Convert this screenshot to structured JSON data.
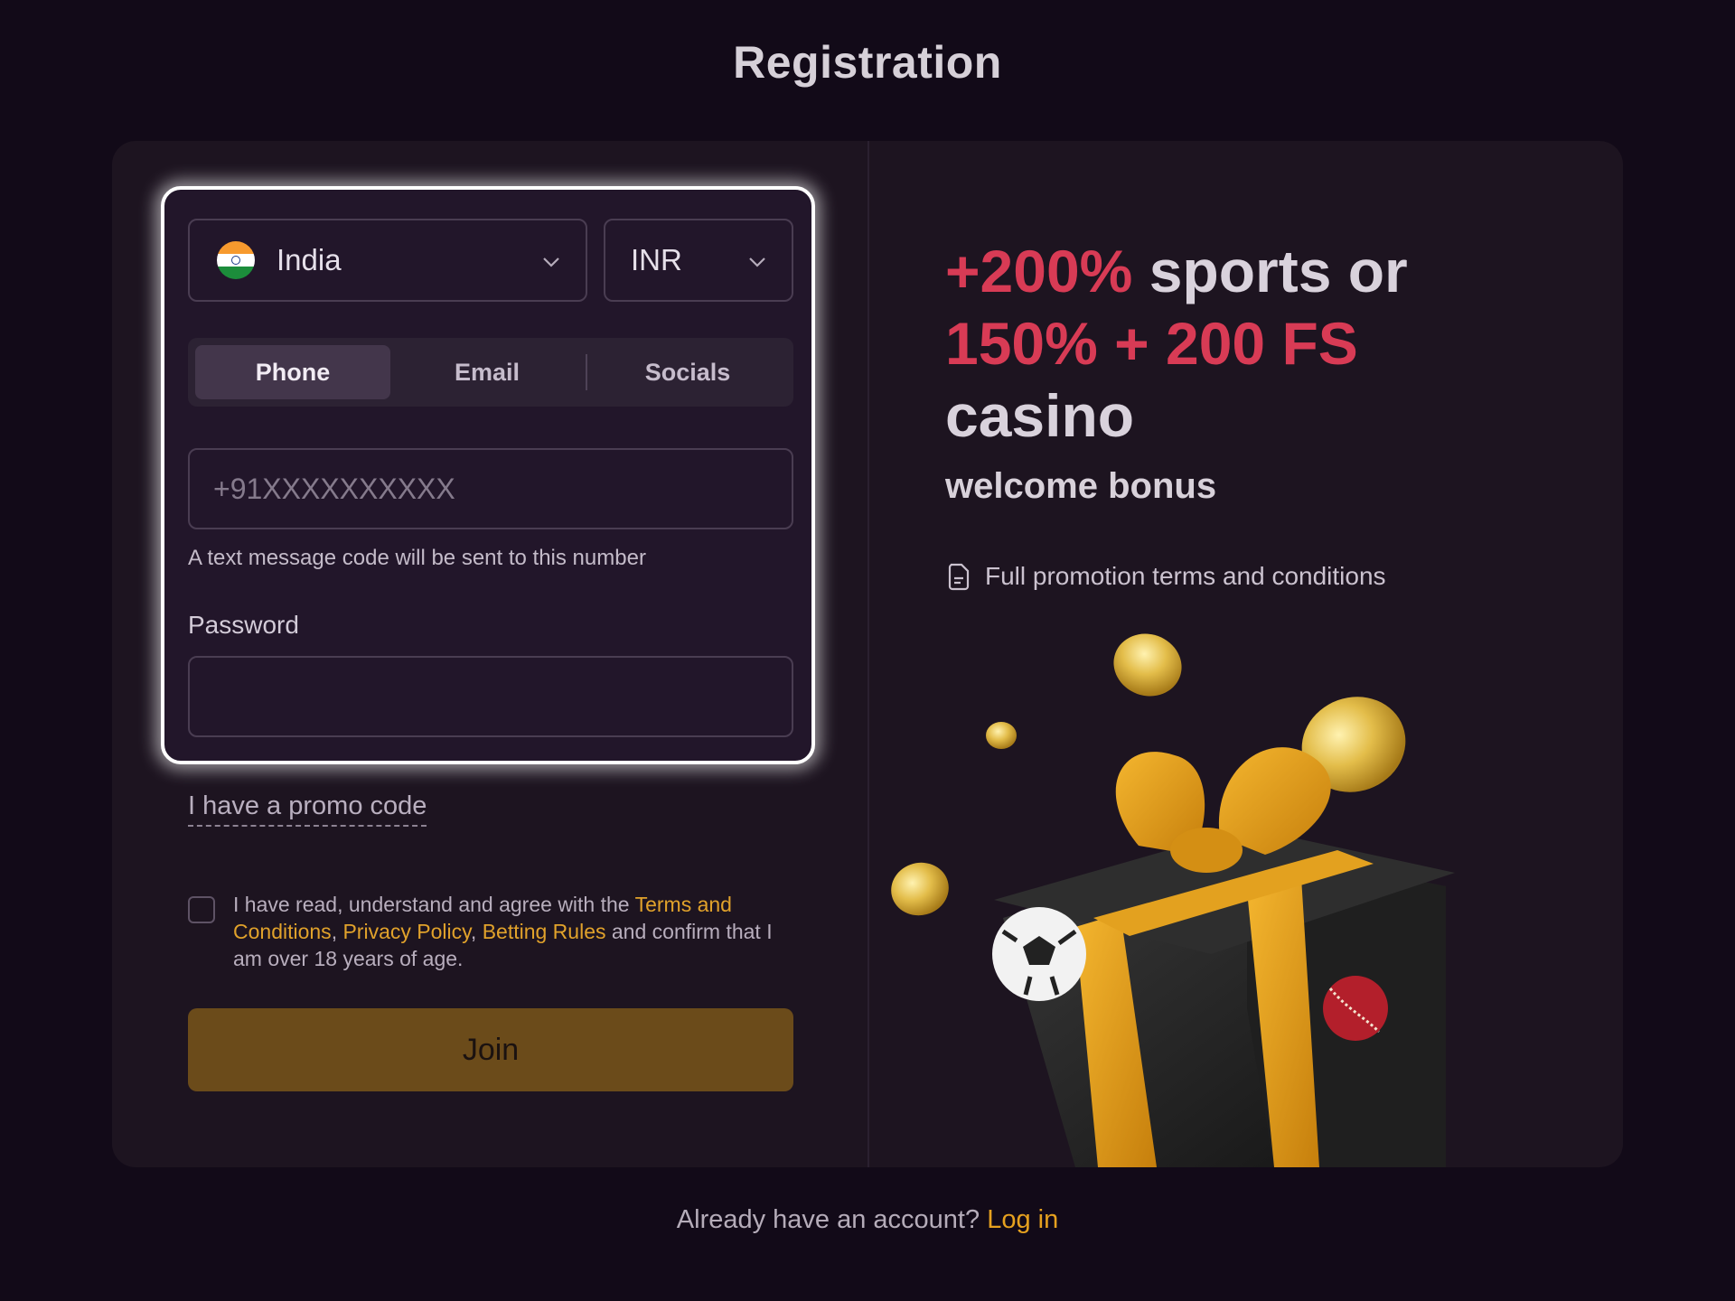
{
  "page": {
    "title": "Registration"
  },
  "form": {
    "country": {
      "value": "India",
      "flag_icon": "india-flag-icon"
    },
    "currency": {
      "value": "INR"
    },
    "tabs": [
      {
        "label": "Phone",
        "active": true
      },
      {
        "label": "Email",
        "active": false
      },
      {
        "label": "Socials",
        "active": false
      }
    ],
    "phone": {
      "placeholder": "+91XXXXXXXXXX",
      "hint": "A text message code will be sent to this number"
    },
    "password": {
      "label": "Password"
    },
    "promo_link": "I have a promo code",
    "agree": {
      "prefix": "I have read, understand and agree with the",
      "terms": "Terms and Conditions",
      "privacy": "Privacy Policy",
      "betting": "Betting Rules",
      "suffix": "and confirm that I am over 18 years of age."
    },
    "join_label": "Join"
  },
  "promo": {
    "line1_accent": "+200%",
    "line1_rest": "sports or",
    "line2_accent": "150% + 200 FS",
    "line3": "casino",
    "welcome": "welcome bonus",
    "terms_link": "Full promotion terms and conditions",
    "image_icon": "gift-box-with-coins-illustration"
  },
  "footer": {
    "question": "Already have an account?",
    "login_label": "Log in"
  },
  "colors": {
    "background": "#120a18",
    "card": "#1d1420",
    "accent_red": "#d83b55",
    "link_gold": "#e1a22b",
    "join_button": "#6b4b1a"
  }
}
